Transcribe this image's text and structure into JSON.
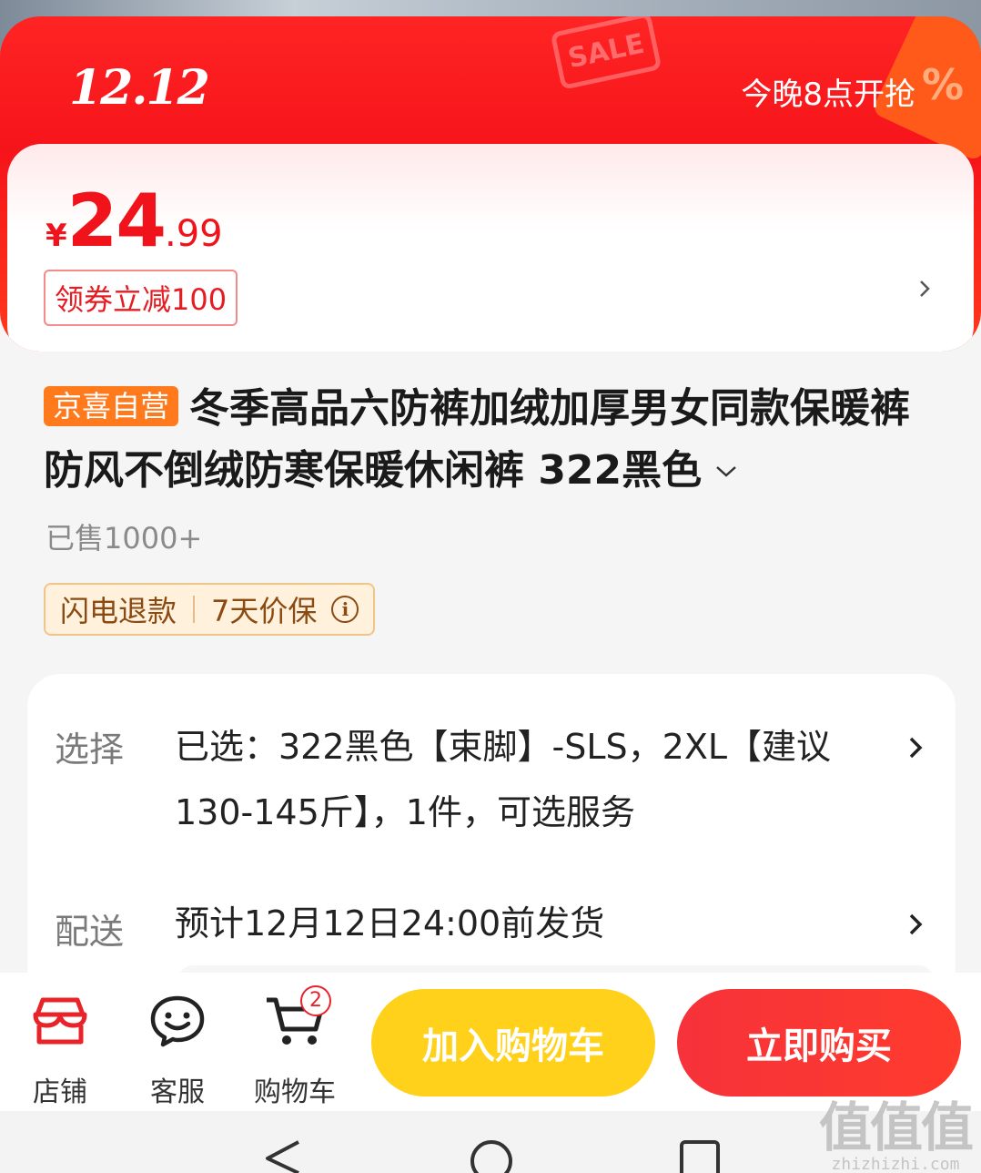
{
  "banner": {
    "event_logo": "12.12",
    "sale_tag": "SALE",
    "percent_symbol": "%",
    "event_time": "今晚8点开抢"
  },
  "price": {
    "symbol": "¥",
    "integer": "24",
    "decimal": ".99",
    "coupon": "领券立减100"
  },
  "product": {
    "store_badge": "京喜自营",
    "title": "冬季高品六防裤加绒加厚男女同款保暖裤防风不倒绒防寒保暖休闲裤 322黑色",
    "sold": "已售1000+",
    "services": [
      "闪电退款",
      "7天价保"
    ]
  },
  "options": {
    "select_label": "选择",
    "select_value": "已选：322黑色【束脚】-SLS，2XL【建议130-145斤】，1件，可选服务",
    "delivery_label": "配送",
    "delivery_value": "预计12月12日24:00前发货"
  },
  "bottom_nav": {
    "store_label": "店铺",
    "service_label": "客服",
    "cart_label": "购物车",
    "cart_count": "2",
    "add_to_cart": "加入购物车",
    "buy_now": "立即购买"
  },
  "watermark": {
    "logo": "值值值",
    "url": "zhizhizhi.com"
  },
  "colors": {
    "brand_red": "#f0131b",
    "store_badge_orange": "#ff7a1d",
    "add_cart_yellow": "#ffd11a",
    "buy_now_red": "#f6323a"
  }
}
